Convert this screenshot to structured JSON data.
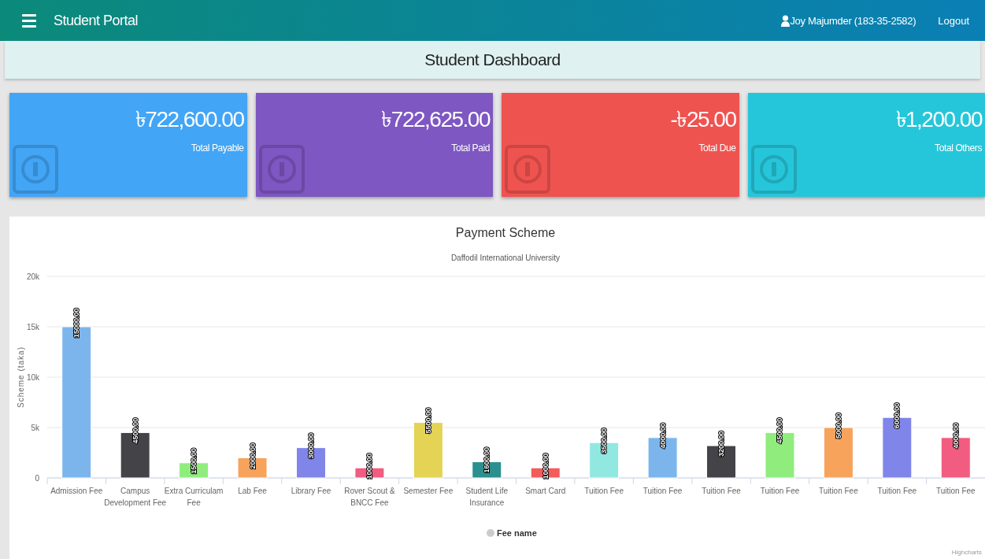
{
  "header": {
    "title": "Student Portal",
    "user": "Joy Majumder (183-35-2582)",
    "logout": "Logout"
  },
  "page_title": "Student Dashboard",
  "cards": [
    {
      "amount": "৳722,600.00",
      "label": "Total Payable",
      "color": "#42a5f5"
    },
    {
      "amount": "৳722,625.00",
      "label": "Total Paid",
      "color": "#7e57c2"
    },
    {
      "amount": "-৳25.00",
      "label": "Total Due",
      "color": "#ef5350"
    },
    {
      "amount": "৳1,200.00",
      "label": "Total Others",
      "color": "#26c6da"
    }
  ],
  "payment_chart": {
    "bars": [
      {
        "color": "#7cb5ec"
      },
      {
        "color": "#434348"
      },
      {
        "color": "#90ed7d"
      },
      {
        "color": "#f7a35c"
      },
      {
        "color": "#8085e9"
      },
      {
        "color": "#f15c80"
      },
      {
        "color": "#e4d354"
      },
      {
        "color": "#2b908f"
      },
      {
        "color": "#f45b5b"
      },
      {
        "color": "#91e8e1"
      },
      {
        "color": "#7cb5ec"
      },
      {
        "color": "#434348"
      },
      {
        "color": "#90ed7d"
      },
      {
        "color": "#f7a35c"
      },
      {
        "color": "#8085e9"
      },
      {
        "color": "#f15c80"
      }
    ],
    "credits": "Highcharts",
    "chart_data": {
      "type": "bar",
      "title": "Payment Scheme",
      "subtitle": "Daffodil International University",
      "ylabel": "Scheme (taka)",
      "categories": [
        "Admission Fee",
        "Campus Development Fee",
        "Extra Curriculam Fee",
        "Lab Fee",
        "Library Fee",
        "Rover Scout & BNCC Fee",
        "Semester Fee",
        "Student Life Insurance",
        "Smart Card",
        "Tuition Fee",
        "Tuition Fee",
        "Tuition Fee",
        "Tuition Fee",
        "Tuition Fee",
        "Tuition Fee",
        "Tuition Fee"
      ],
      "series": [
        {
          "name": "Fee name",
          "values": [
            15000,
            4500,
            1500,
            2000,
            3000,
            1000,
            5500,
            1600,
            1000,
            3500,
            4000,
            3200,
            4500,
            5000,
            6000,
            4000
          ]
        }
      ],
      "value_labels": [
        "15000.00",
        "4500.00",
        "1500.00",
        "2000.00",
        "3000.00",
        "1000.00",
        "5500.00",
        "1600.00",
        "1000.00",
        "3500.00",
        "4000.00",
        "3200.00",
        "4500.00",
        "5000.00",
        "6000.00",
        "4000.00"
      ],
      "grid": true,
      "ylim": [
        0,
        20000
      ],
      "yticks": [
        {
          "value": 0,
          "label": "0"
        },
        {
          "value": 5000,
          "label": "5k"
        },
        {
          "value": 10000,
          "label": "10k"
        },
        {
          "value": 15000,
          "label": "15k"
        },
        {
          "value": 20000,
          "label": "20k"
        }
      ]
    }
  }
}
